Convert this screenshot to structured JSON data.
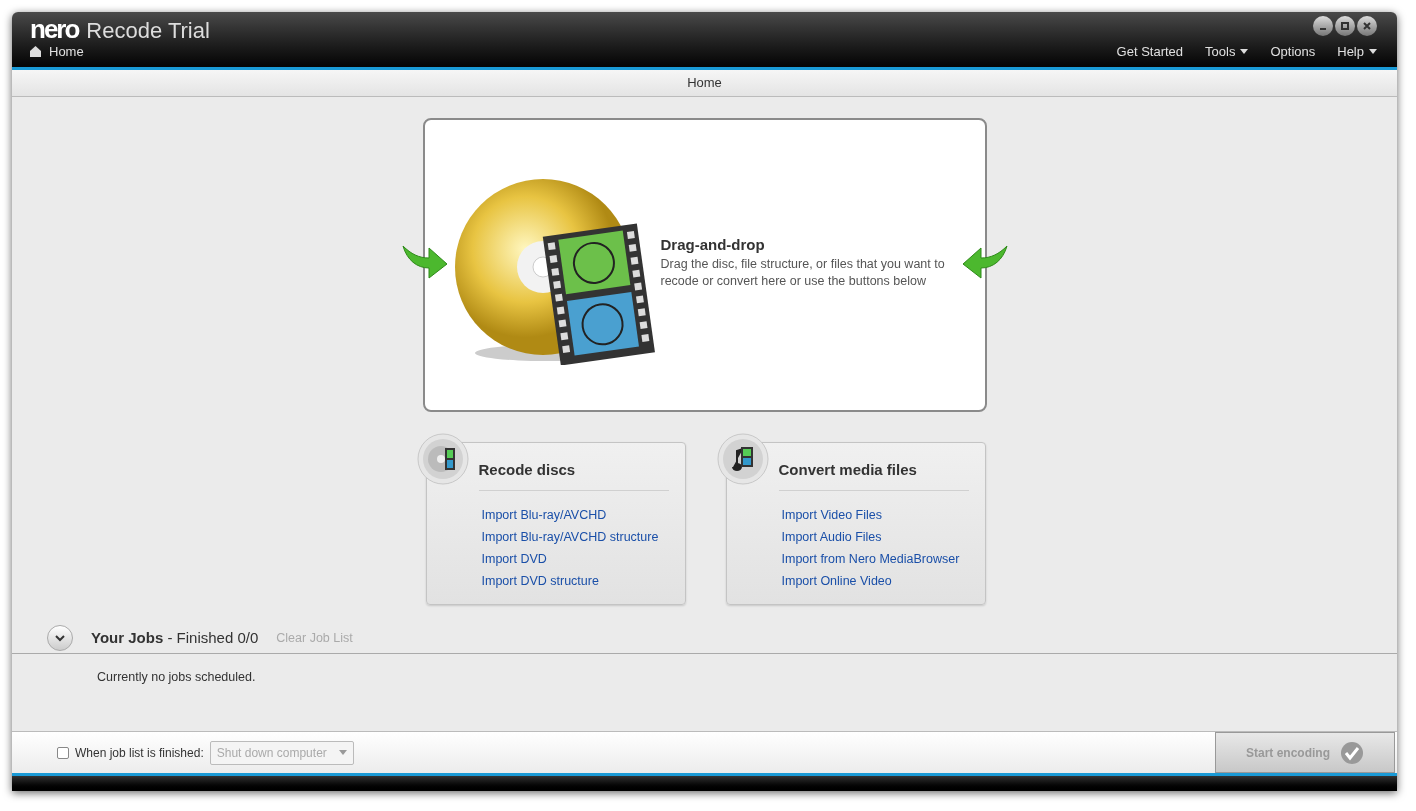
{
  "window": {
    "logo": "nero",
    "title": "Recode Trial"
  },
  "breadcrumb": {
    "label": "Home"
  },
  "menu": [
    {
      "label": "Get Started",
      "dropdown": false
    },
    {
      "label": "Tools",
      "dropdown": true
    },
    {
      "label": "Options",
      "dropdown": false
    },
    {
      "label": "Help",
      "dropdown": true
    }
  ],
  "page_title": "Home",
  "drop_zone": {
    "title": "Drag-and-drop",
    "text": "Drag the disc, file structure, or files that you want to recode or convert here or use the buttons below"
  },
  "panels": [
    {
      "kind": "disc",
      "title": "Recode discs",
      "links": [
        "Import Blu-ray/AVCHD",
        "Import Blu-ray/AVCHD structure",
        "Import DVD",
        "Import DVD structure"
      ]
    },
    {
      "kind": "media",
      "title": "Convert media files",
      "links": [
        "Import Video Files",
        "Import Audio Files",
        "Import from Nero MediaBrowser",
        "Import Online Video"
      ]
    }
  ],
  "jobs": {
    "title": "Your Jobs",
    "status": "- Finished 0/0",
    "expanded": true,
    "clear": {
      "label": "Clear Job List",
      "disabled": true
    },
    "empty_text": "Currently no jobs scheduled."
  },
  "footer": {
    "when_finished": {
      "label": "When job list is finished:",
      "checked": false
    },
    "action": {
      "value": "Shut down computer",
      "disabled": true
    },
    "start": {
      "label": "Start encoding",
      "disabled": true
    }
  }
}
